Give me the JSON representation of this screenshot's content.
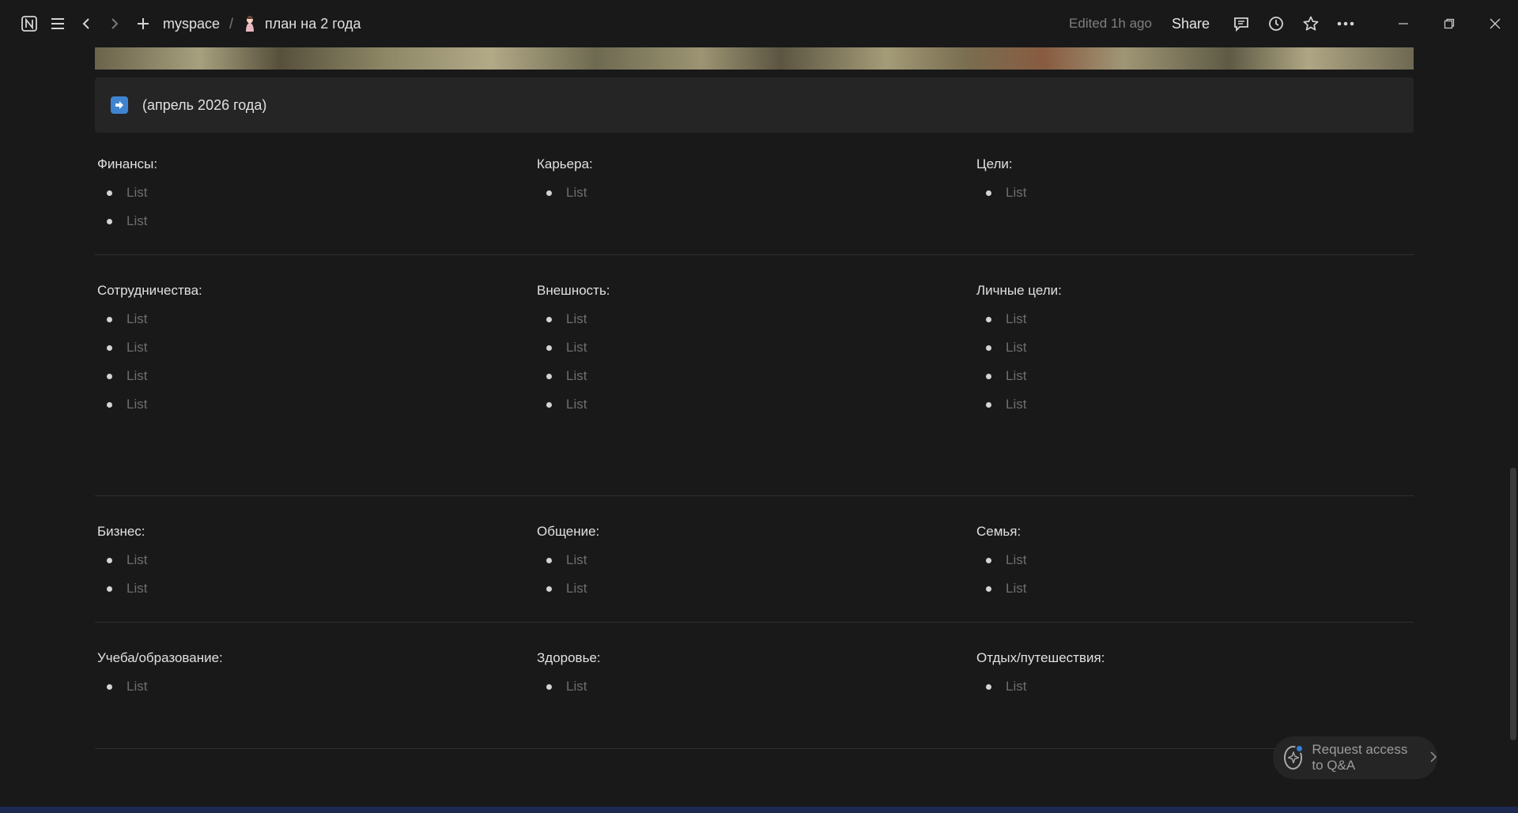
{
  "titlebar": {
    "workspace": "myspace",
    "separator": "/",
    "page_title": "план на 2 года",
    "edited": "Edited 1h ago",
    "share": "Share"
  },
  "callout": {
    "icon": "arrow-right-icon",
    "text": "(апрель 2026 года)"
  },
  "sections": [
    [
      {
        "title": "Финансы:",
        "items": [
          "List",
          "List"
        ]
      },
      {
        "title": "Карьера:",
        "items": [
          "List"
        ]
      },
      {
        "title": "Цели:",
        "items": [
          "List"
        ]
      }
    ],
    [
      {
        "title": "Сотрудничества:",
        "items": [
          "List",
          "List",
          "List",
          "List"
        ]
      },
      {
        "title": "Внешность:",
        "items": [
          "List",
          "List",
          "List",
          "List"
        ]
      },
      {
        "title": "Личные цели:",
        "items": [
          "List",
          "List",
          "List",
          "List"
        ]
      }
    ],
    [
      {
        "title": "Бизнес:",
        "items": [
          "List",
          "List"
        ]
      },
      {
        "title": "Общение:",
        "items": [
          "List",
          "List"
        ]
      },
      {
        "title": "Семья:",
        "items": [
          "List",
          "List"
        ]
      }
    ],
    [
      {
        "title": "Учеба/образование:",
        "items": [
          "List"
        ]
      },
      {
        "title": "Здоровье:",
        "items": [
          "List"
        ]
      },
      {
        "title": "Отдых/путешествия:",
        "items": [
          "List"
        ]
      }
    ]
  ],
  "qa": {
    "label": "Request access to Q&A"
  },
  "colors": {
    "background": "#191919",
    "callout_bg": "#252525",
    "accent_blue": "#3f84d1"
  }
}
